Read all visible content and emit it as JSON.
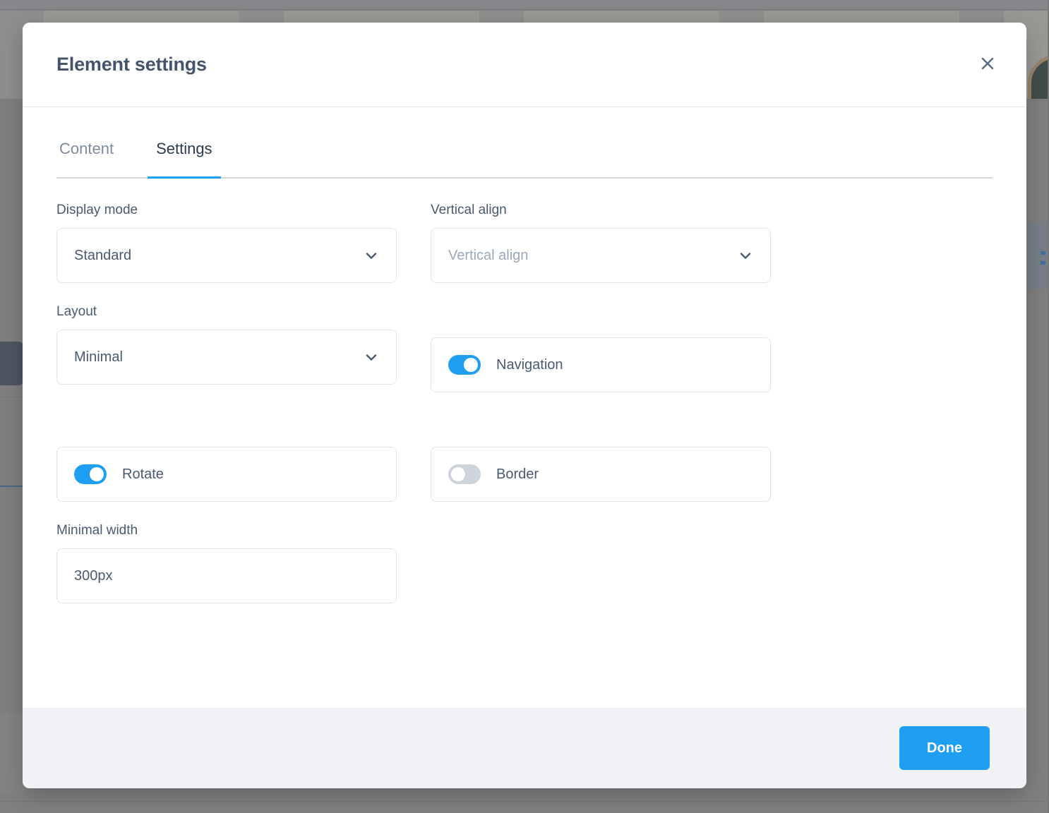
{
  "modal": {
    "title": "Element settings",
    "close_icon": "close-icon",
    "tabs": [
      {
        "label": "Content",
        "active": false
      },
      {
        "label": "Settings",
        "active": true
      }
    ],
    "fields": {
      "display_mode": {
        "label": "Display mode",
        "value": "Standard",
        "icon": "chevron-down-icon"
      },
      "vertical_align": {
        "label": "Vertical align",
        "value": "",
        "placeholder": "Vertical align",
        "icon": "chevron-down-icon"
      },
      "layout": {
        "label": "Layout",
        "value": "Minimal",
        "icon": "chevron-down-icon"
      },
      "navigation": {
        "label": "Navigation",
        "state": "on"
      },
      "rotate": {
        "label": "Rotate",
        "state": "on"
      },
      "border": {
        "label": "Border",
        "state": "off"
      },
      "minimal_width": {
        "label": "Minimal width",
        "value": "300px",
        "placeholder": "Minimal width"
      }
    },
    "footer": {
      "done_label": "Done"
    }
  },
  "colors": {
    "accent": "#1e9ff2",
    "title_text": "#44556b",
    "label_text": "#4a5a6e",
    "placeholder_text": "#9aa8b8",
    "inactive_tab": "#7e8b9c",
    "border": "#e2e6eb",
    "footer_bg": "#f1f2f6",
    "toggle_off": "#cdd4dc"
  }
}
